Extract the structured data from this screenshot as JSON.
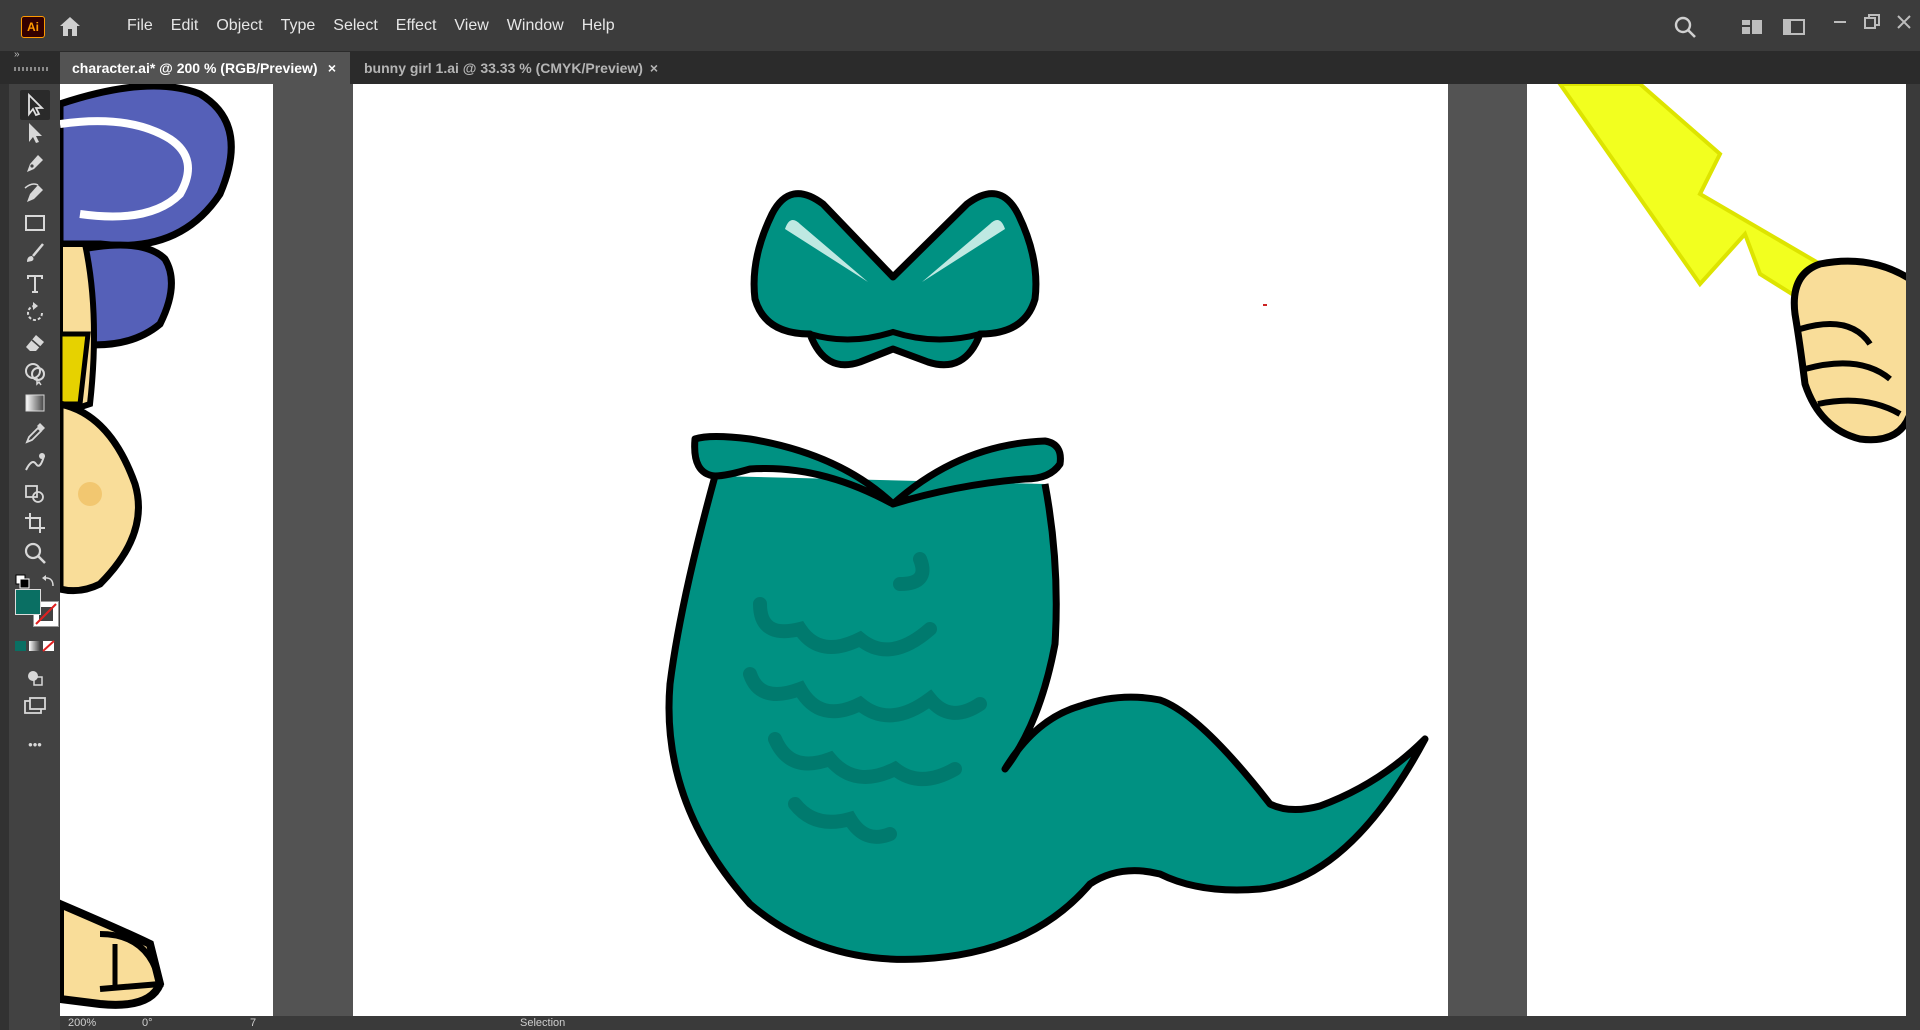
{
  "app": {
    "logo": "Ai"
  },
  "menu": [
    "File",
    "Edit",
    "Object",
    "Type",
    "Select",
    "Effect",
    "View",
    "Window",
    "Help"
  ],
  "header_icons": [
    "home-icon",
    "search-icon",
    "workspace-switcher-icon",
    "panel-toggle-icon",
    "minimize-icon",
    "restore-icon",
    "close-icon"
  ],
  "tabs": [
    {
      "title": "character.ai* @ 200 % (RGB/Preview)",
      "active": true,
      "close": "×"
    },
    {
      "title": "bunny girl 1.ai @ 33.33 % (CMYK/Preview)",
      "active": false,
      "close": "×"
    }
  ],
  "toolbar": {
    "collapse": "»",
    "tools": [
      "selection-tool-icon",
      "direct-selection-tool-icon",
      "pen-tool-icon",
      "curvature-tool-icon",
      "rectangle-tool-icon",
      "paintbrush-tool-icon",
      "type-tool-icon",
      "rotate-tool-icon",
      "eraser-tool-icon",
      "shape-builder-tool-icon",
      "gradient-tool-icon",
      "eyedropper-tool-icon",
      "puppet-warp-tool-icon",
      "symbol-sprayer-tool-icon",
      "artboard-tool-icon",
      "zoom-tool-icon"
    ],
    "more": "•••",
    "fill_color": "#0a6f63",
    "stroke_color": "none"
  },
  "colors": {
    "mermaid_fill": "#009182",
    "mermaid_scales": "#007a6e",
    "outline": "#000000",
    "hair": "#5560b8",
    "skin": "#f9dd99",
    "bolt": "#f2ff1f",
    "pasteboard": "#535353"
  },
  "statusbar": {
    "zoom": "200%",
    "angle": "0°",
    "artboard": "7",
    "mode": "Selection"
  }
}
